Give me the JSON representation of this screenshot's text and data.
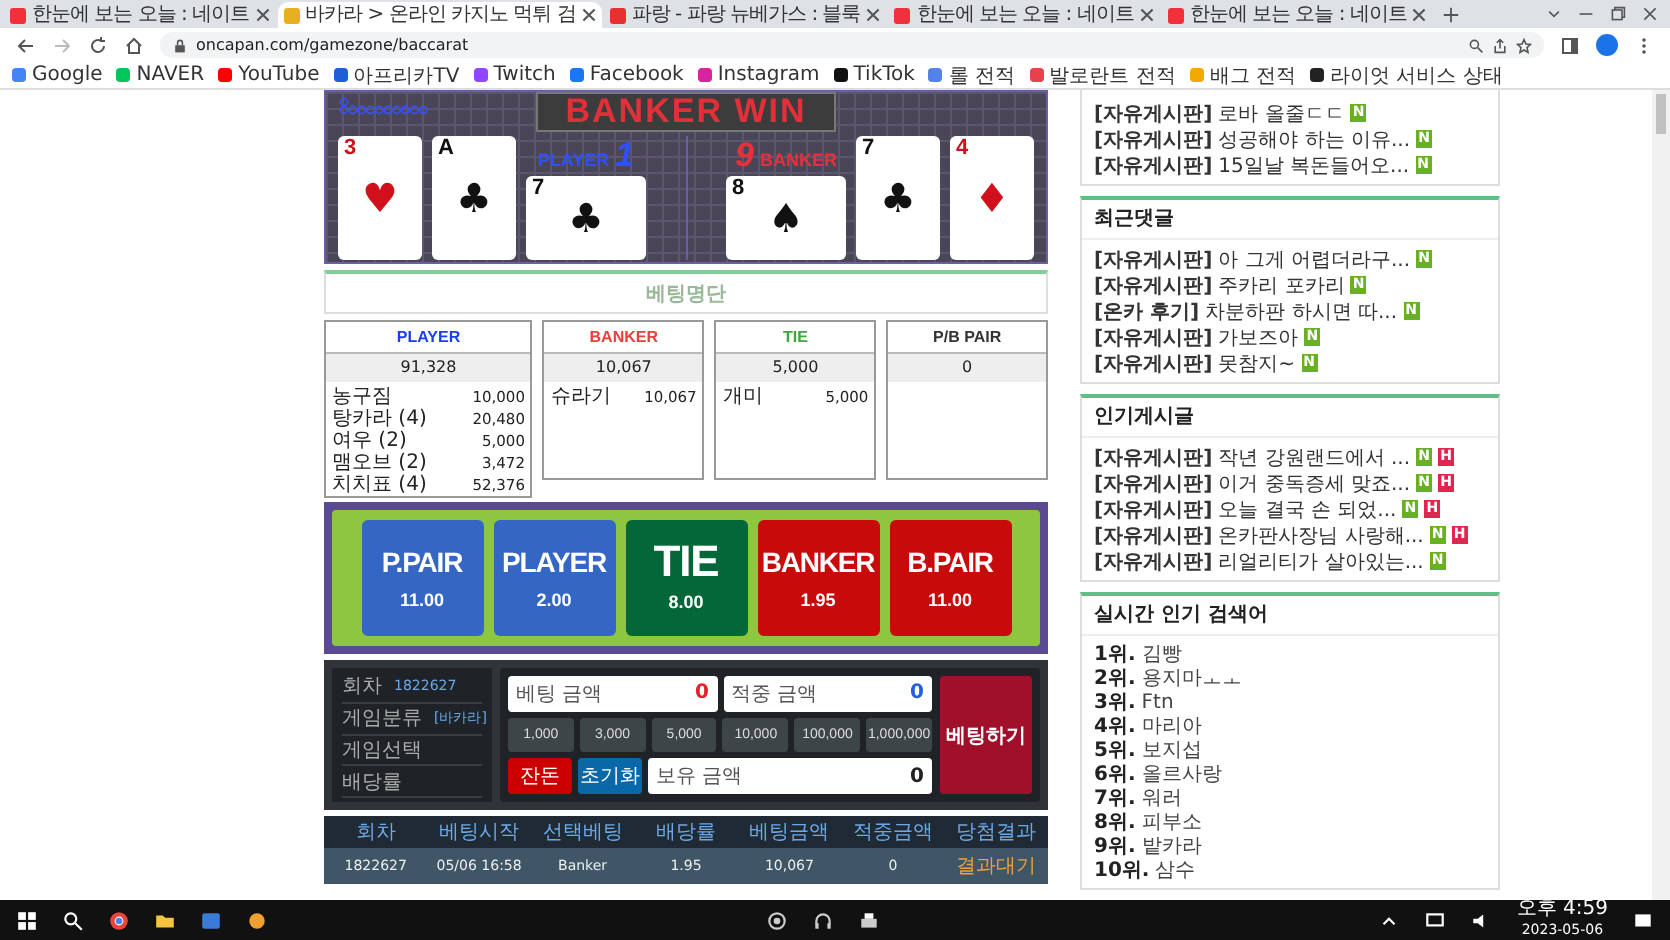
{
  "browser": {
    "tabs": [
      {
        "title": "한눈에 보는 오늘 : 네이트",
        "kind": "nate",
        "selected": false
      },
      {
        "title": "바카라 > 온라인 카지노 먹튀 검",
        "kind": "casino",
        "selected": true
      },
      {
        "title": "파랑 - 파랑 뉴베가스 : 블룩",
        "kind": "video",
        "selected": false
      },
      {
        "title": "한눈에 보는 오늘 : 네이트",
        "kind": "nate",
        "selected": false
      },
      {
        "title": "한눈에 보는 오늘 : 네이트",
        "kind": "nate",
        "selected": false
      }
    ],
    "address": "oncapan.com/gamezone/baccarat",
    "bookmarks": [
      {
        "label": "Google",
        "color": "#4285f4"
      },
      {
        "label": "NAVER",
        "color": "#03c75a"
      },
      {
        "label": "YouTube",
        "color": "#ff0000"
      },
      {
        "label": "아프리카TV",
        "color": "#1f5fd6"
      },
      {
        "label": "Twitch",
        "color": "#9146ff"
      },
      {
        "label": "Facebook",
        "color": "#1877f2"
      },
      {
        "label": "Instagram",
        "color": "#d6249f"
      },
      {
        "label": "TikTok",
        "color": "#111111"
      },
      {
        "label": "롤 전적",
        "color": "#5383e8"
      },
      {
        "label": "발로란트 전적",
        "color": "#e8404c"
      },
      {
        "label": "배그 전적",
        "color": "#f2a900"
      },
      {
        "label": "라이엇 서비스 상태",
        "color": "#222222"
      }
    ]
  },
  "game": {
    "banner": "BANKER WIN",
    "player": {
      "label": "PLAYER",
      "score": "1",
      "cards": [
        {
          "rank": "3",
          "suit": "♥",
          "color": "#d0101a",
          "sideways": false
        },
        {
          "rank": "A",
          "suit": "♣",
          "color": "#111111",
          "sideways": false
        },
        {
          "rank": "7",
          "suit": "♣",
          "color": "#111111",
          "sideways": true
        }
      ]
    },
    "banker": {
      "label": "BANKER",
      "score": "9",
      "cards": [
        {
          "rank": "8",
          "suit": "♠",
          "color": "#111111",
          "sideways": true
        },
        {
          "rank": "7",
          "suit": "♣",
          "color": "#111111",
          "sideways": false
        },
        {
          "rank": "4",
          "suit": "♦",
          "color": "#d0101a",
          "sideways": false
        }
      ]
    }
  },
  "bet_list": {
    "title": "베팅명단",
    "columns": [
      {
        "name": "PLAYER",
        "color": "#1a3cff",
        "total": "91,328",
        "bettors": [
          {
            "name": "농구짐",
            "amount": "10,000"
          },
          {
            "name": "탕카라 (4)",
            "amount": "20,480"
          },
          {
            "name": "여우 (2)",
            "amount": "5,000"
          },
          {
            "name": "맴오브 (2)",
            "amount": "3,472"
          },
          {
            "name": "치치표 (4)",
            "amount": "52,376"
          }
        ]
      },
      {
        "name": "BANKER",
        "color": "#e8403a",
        "total": "10,067",
        "bettors": [
          {
            "name": "슈라기",
            "amount": "10,067"
          }
        ]
      },
      {
        "name": "TIE",
        "color": "#3aa83a",
        "total": "5,000",
        "bettors": [
          {
            "name": "개미",
            "amount": "5,000"
          }
        ]
      },
      {
        "name": "P/B PAIR",
        "color": "#333333",
        "total": "0"
      }
    ]
  },
  "bet_options": [
    {
      "label": "P.PAIR",
      "odds": "11.00",
      "color": "#3467c4"
    },
    {
      "label": "PLAYER",
      "odds": "2.00",
      "color": "#3467c4"
    },
    {
      "label": "TIE",
      "odds": "8.00",
      "color": "#04673a"
    },
    {
      "label": "BANKER",
      "odds": "1.95",
      "color": "#c90a0a"
    },
    {
      "label": "B.PAIR",
      "odds": "11.00",
      "color": "#c90a0a"
    }
  ],
  "bet_panel": {
    "info": [
      {
        "label": "회차",
        "value": "1822627"
      },
      {
        "label": "게임분류",
        "value": "[바카라]"
      },
      {
        "label": "게임선택"
      },
      {
        "label": "배당률"
      }
    ],
    "bet_amount": {
      "label": "베팅 금액",
      "value": "0"
    },
    "win_amount": {
      "label": "적중 금액",
      "value": "0"
    },
    "chips": [
      "1,000",
      "3,000",
      "5,000",
      "10,000",
      "100,000",
      "1,000,000"
    ],
    "change_button": "잔돈",
    "reset_button": "초기화",
    "balance": {
      "label": "보유 금액",
      "value": "0"
    },
    "submit_button": "베팅하기"
  },
  "history": {
    "columns": [
      "회차",
      "베팅시작",
      "선택베팅",
      "배당률",
      "베팅금액",
      "적중금액",
      "당첨결과"
    ],
    "rows": [
      [
        "1822627",
        "05/06 16:58",
        "Banker",
        "1.95",
        "10,067",
        "0",
        "결과대기"
      ]
    ]
  },
  "sidebar": {
    "sections": [
      {
        "items": [
          {
            "board": "[자유게시판]",
            "title": "로바 올줄ㄷㄷ",
            "badges": [
              {
                "label": "N",
                "color": "#6ab023"
              }
            ]
          },
          {
            "board": "[자유게시판]",
            "title": "성공해야 하는 이유...",
            "badges": [
              {
                "label": "N",
                "color": "#6ab023"
              }
            ]
          },
          {
            "board": "[자유게시판]",
            "title": "15일날 복돈들어오...",
            "badges": [
              {
                "label": "N",
                "color": "#6ab023"
              }
            ]
          }
        ]
      },
      {
        "title": "최근댓글",
        "items": [
          {
            "board": "[자유게시판]",
            "title": "아 그게 어렵더라구...",
            "badges": [
              {
                "label": "N",
                "color": "#6ab023"
              }
            ]
          },
          {
            "board": "[자유게시판]",
            "title": "주카리 포카리",
            "badges": [
              {
                "label": "N",
                "color": "#6ab023"
              }
            ]
          },
          {
            "board": "[온카 후기]",
            "title": "차분하판 하시면 따...",
            "badges": [
              {
                "label": "N",
                "color": "#6ab023"
              }
            ]
          },
          {
            "board": "[자유게시판]",
            "title": "가보즈아",
            "badges": [
              {
                "label": "N",
                "color": "#6ab023"
              }
            ]
          },
          {
            "board": "[자유게시판]",
            "title": "못참지~",
            "badges": [
              {
                "label": "N",
                "color": "#6ab023"
              }
            ]
          }
        ]
      },
      {
        "title": "인기게시글",
        "items": [
          {
            "board": "[자유게시판]",
            "title": "작년 강원랜드에서 ...",
            "badges": [
              {
                "label": "N",
                "color": "#6ab023"
              },
              {
                "label": "H",
                "color": "#e0264e"
              }
            ]
          },
          {
            "board": "[자유게시판]",
            "title": "이거 중독증세 맞죠...",
            "badges": [
              {
                "label": "N",
                "color": "#6ab023"
              },
              {
                "label": "H",
                "color": "#e0264e"
              }
            ]
          },
          {
            "board": "[자유게시판]",
            "title": "오늘 결국 손 되었...",
            "badges": [
              {
                "label": "N",
                "color": "#6ab023"
              },
              {
                "label": "H",
                "color": "#e0264e"
              }
            ]
          },
          {
            "board": "[자유게시판]",
            "title": "온카판사장님 사랑해...",
            "badges": [
              {
                "label": "N",
                "color": "#6ab023"
              },
              {
                "label": "H",
                "color": "#e0264e"
              }
            ]
          },
          {
            "board": "[자유게시판]",
            "title": "리얼리티가 살아있는...",
            "badges": [
              {
                "label": "N",
                "color": "#6ab023"
              }
            ]
          }
        ]
      }
    ],
    "ranking": {
      "title": "실시간 인기 검색어",
      "items": [
        {
          "rank": "1위.",
          "term": "김빵"
        },
        {
          "rank": "2위.",
          "term": "용지마ㅗㅗ"
        },
        {
          "rank": "3위.",
          "term": "Ftn"
        },
        {
          "rank": "4위.",
          "term": "마리아"
        },
        {
          "rank": "5위.",
          "term": "보지섭"
        },
        {
          "rank": "6위.",
          "term": "올르사랑"
        },
        {
          "rank": "7위.",
          "term": "워러"
        },
        {
          "rank": "8위.",
          "term": "피부소"
        },
        {
          "rank": "9위.",
          "term": "밭카라"
        },
        {
          "rank": "10위.",
          "term": "삼수"
        }
      ]
    }
  },
  "taskbar": {
    "time": "오후 4:59",
    "date": "2023-05-06"
  }
}
